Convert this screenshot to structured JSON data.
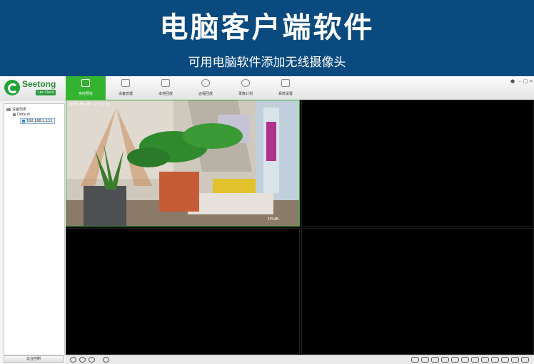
{
  "banner": {
    "title": "电脑客户端软件",
    "subtitle": "可用电脑软件添加无线摄像头"
  },
  "app": {
    "logo": {
      "name": "Seetong",
      "tagline": "Lite Client"
    },
    "toolbar": [
      {
        "label": "实时预览",
        "icon": "monitor-icon",
        "active": true
      },
      {
        "label": "设备管理",
        "icon": "device-icon",
        "active": false
      },
      {
        "label": "本地回放",
        "icon": "film-icon",
        "active": false
      },
      {
        "label": "远程回放",
        "icon": "replay-icon",
        "active": false
      },
      {
        "label": "录像计划",
        "icon": "schedule-icon",
        "active": false
      },
      {
        "label": "系统设置",
        "icon": "settings-icon",
        "active": false
      }
    ],
    "device_tree": {
      "root": "设备列表",
      "group": "Default",
      "device": "192.168.1.111"
    },
    "sidebar_button": "云台控制",
    "video": {
      "osd_date": "2020-06-08  17:32:23",
      "osd_name": "IPCAM"
    },
    "colors": {
      "accent": "#35b332",
      "banner": "#0a4a7e"
    }
  }
}
